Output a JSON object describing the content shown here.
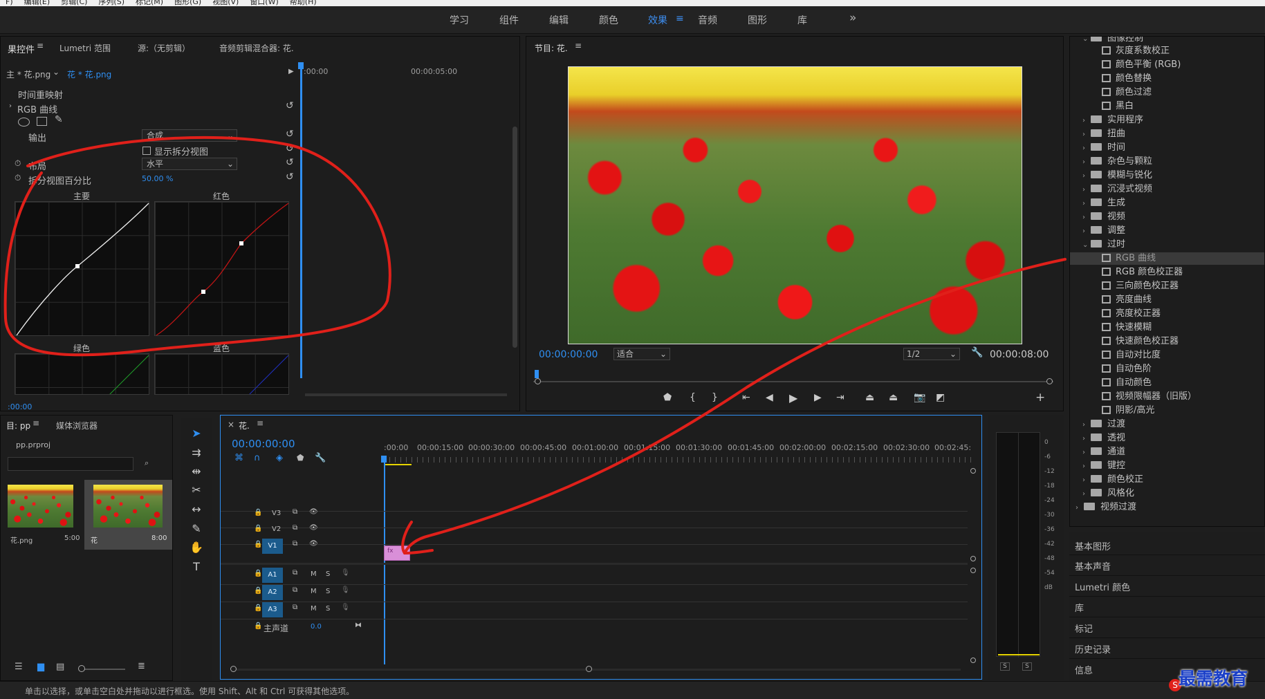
{
  "menubar": {
    "items": [
      "F)",
      "编辑(E)",
      "剪辑(C)",
      "序列(S)",
      "标记(M)",
      "图形(G)",
      "视图(V)",
      "窗口(W)",
      "帮助(H)"
    ]
  },
  "workspaces": {
    "items": [
      "学习",
      "组件",
      "编辑",
      "颜色",
      "效果",
      "音频",
      "图形",
      "库"
    ],
    "active": "效果",
    "more": "»"
  },
  "effect_controls": {
    "tabs": {
      "effect_controls": "果控件",
      "lumetri_scopes": "Lumetri 范围",
      "source": "源:（无剪辑）",
      "audio_mixer": "音频剪辑混合器: 花."
    },
    "clip_master": "主 * 花.png",
    "clip_seq": "花 * 花.png",
    "ruler_start": ":00:00",
    "ruler_mid": "00:00:05:00",
    "time_remap": "时间重映射",
    "rgb_curves": "RGB 曲线",
    "output_label": "输出",
    "output_value": "合成",
    "split_view_label": "显示拆分视图",
    "layout_label": "布局",
    "layout_value": "水平",
    "split_percent_label": "拆分视图百分比",
    "split_percent_value": "50.00 %",
    "curves": {
      "master": "主要",
      "red": "红色",
      "green": "绿色",
      "blue": "蓝色"
    },
    "timecode": ":00:00"
  },
  "program": {
    "title": "节目: 花.",
    "timecode": "00:00:00:00",
    "fit": "适合",
    "resolution": "1/2",
    "duration": "00:00:08:00"
  },
  "effects_panel": {
    "top": "图像控制",
    "image_control_items": [
      "灰度系数校正",
      "颜色平衡 (RGB)",
      "颜色替换",
      "颜色过滤",
      "黑白"
    ],
    "folders_a": [
      "实用程序",
      "扭曲",
      "时间",
      "杂色与颗粒",
      "模糊与锐化",
      "沉浸式视频",
      "生成",
      "视频",
      "调整"
    ],
    "obsolete": "过时",
    "obsolete_items": [
      "RGB 曲线",
      "RGB 颜色校正器",
      "三向颜色校正器",
      "亮度曲线",
      "亮度校正器",
      "快速模糊",
      "快速颜色校正器",
      "自动对比度",
      "自动色阶",
      "自动颜色",
      "视频限幅器（旧版）",
      "阴影/高光"
    ],
    "folders_b": [
      "过渡",
      "透视",
      "通道",
      "键控",
      "颜色校正",
      "风格化"
    ],
    "video_transitions": "视频过渡",
    "sections": [
      "基本图形",
      "基本声音",
      "Lumetri 颜色",
      "库",
      "标记",
      "历史记录",
      "信息"
    ]
  },
  "project": {
    "tab": "目: pp",
    "media_browser": "媒体浏览器",
    "file": "pp.prproj",
    "thumbs": [
      {
        "name": "花.png",
        "dur": "5:00"
      },
      {
        "name": "花",
        "dur": "8:00"
      }
    ]
  },
  "timeline": {
    "tab": "花.",
    "timecode": "00:00:00:00",
    "ruler": [
      ":00:00",
      "00:00:15:00",
      "00:00:30:00",
      "00:00:45:00",
      "00:01:00:00",
      "00:01:15:00",
      "00:01:30:00",
      "00:01:45:00",
      "00:02:00:00",
      "00:02:15:00",
      "00:02:30:00",
      "00:02:45:"
    ],
    "video_tracks": [
      "V3",
      "V2",
      "V1"
    ],
    "audio_tracks": [
      "A1",
      "A2",
      "A3"
    ],
    "master": "主声道",
    "master_val": "0.0",
    "clip_label": "fx"
  },
  "vu": {
    "scale": [
      "0",
      "-6",
      "-12",
      "-18",
      "-24",
      "-30",
      "-36",
      "-42",
      "-48",
      "-54",
      "dB"
    ],
    "solo": "S"
  },
  "statusbar": "单击以选择，或单击空白处并拖动以进行框选。使用 Shift、Alt 和 Ctrl 可获得其他选项。",
  "watermark": "最需教育",
  "colors": {
    "accent": "#2f8ff2",
    "annotation": "#e0201a",
    "track_blue": "#1b5b8c"
  }
}
